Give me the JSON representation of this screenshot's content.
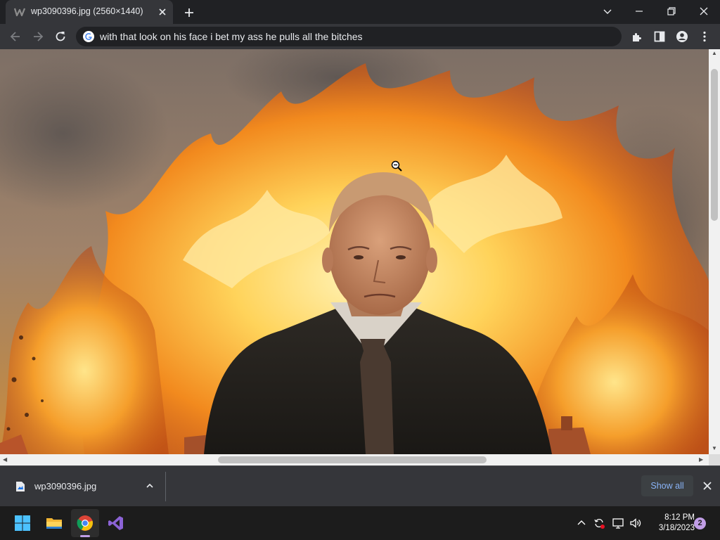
{
  "browser": {
    "tab": {
      "title": "wp3090396.jpg (2560×1440)",
      "favicon": "w-logo-icon"
    },
    "address_bar": {
      "text": "with that look on his face i bet my ass he pulls all the bitches",
      "engine_icon": "google-g-icon"
    },
    "toolbar_icons": [
      "back-icon",
      "forward-icon",
      "reload-icon",
      "extensions-icon",
      "side-panel-icon",
      "profile-icon",
      "menu-icon"
    ],
    "window_controls": [
      "tab-search-icon",
      "minimize-icon",
      "restore-icon",
      "close-icon"
    ]
  },
  "viewer": {
    "image_name": "wp3090396.jpg",
    "cursor": "zoom-out-icon",
    "scene": "figure-in-suit-before-fire"
  },
  "downloads": {
    "items": [
      {
        "name": "wp3090396.jpg"
      }
    ],
    "show_all_label": "Show all"
  },
  "taskbar": {
    "apps": [
      "start-icon",
      "file-explorer-icon",
      "chrome-icon",
      "visual-studio-icon"
    ],
    "clock": {
      "time": "8:12 PM",
      "date": "3/18/2023"
    },
    "notification_count": "2"
  },
  "colors": {
    "chrome_dark": "#202124",
    "toolbar": "#35363a",
    "link_blue": "#8ab4f8",
    "taskbar": "#1c1c1c"
  }
}
